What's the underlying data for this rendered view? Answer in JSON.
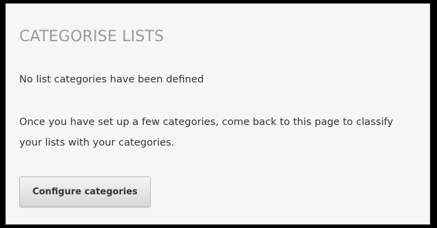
{
  "panel": {
    "title": "CATEGORISE LISTS",
    "empty_message": "No list categories have been defined",
    "help_message": "Once you have set up a few categories, come back to this page to classify your lists with your categories.",
    "configure_button_label": "Configure categories"
  }
}
